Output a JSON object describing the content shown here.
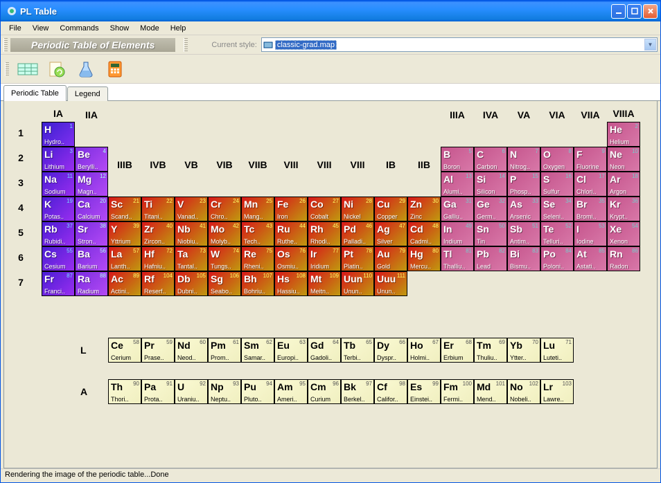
{
  "window": {
    "title": "PL Table"
  },
  "menu": [
    "File",
    "View",
    "Commands",
    "Show",
    "Mode",
    "Help"
  ],
  "banner": "Periodic Table of Elements",
  "styleLabel": "Current style:",
  "styleValue": "classic-grad.map",
  "tabs": [
    {
      "label": "Periodic Table",
      "active": true
    },
    {
      "label": "Legend",
      "active": false
    }
  ],
  "status": "Rendering the image of the periodic table...Done",
  "groupLabels": [
    {
      "t": "IA",
      "col": 0,
      "row": -1
    },
    {
      "t": "IIA",
      "col": 1,
      "row": 0
    },
    {
      "t": "IIIB",
      "col": 2,
      "row": 2
    },
    {
      "t": "IVB",
      "col": 3,
      "row": 2
    },
    {
      "t": "VB",
      "col": 4,
      "row": 2
    },
    {
      "t": "VIB",
      "col": 5,
      "row": 2
    },
    {
      "t": "VIIB",
      "col": 6,
      "row": 2
    },
    {
      "t": "VIII",
      "col": 7,
      "row": 2
    },
    {
      "t": "VIII",
      "col": 8,
      "row": 2
    },
    {
      "t": "VIII",
      "col": 9,
      "row": 2
    },
    {
      "t": "IB",
      "col": 10,
      "row": 2
    },
    {
      "t": "IIB",
      "col": 11,
      "row": 2
    },
    {
      "t": "IIIA",
      "col": 12,
      "row": 0
    },
    {
      "t": "IVA",
      "col": 13,
      "row": 0
    },
    {
      "t": "VA",
      "col": 14,
      "row": 0
    },
    {
      "t": "VIA",
      "col": 15,
      "row": 0
    },
    {
      "t": "VIIA",
      "col": 16,
      "row": 0
    },
    {
      "t": "VIIIA",
      "col": 17,
      "row": -1
    }
  ],
  "periods": [
    "1",
    "2",
    "3",
    "4",
    "5",
    "6",
    "7"
  ],
  "elements": [
    {
      "n": 1,
      "s": "H",
      "nm": "Hydro..",
      "c": "c-h",
      "col": 0,
      "row": 0
    },
    {
      "n": 2,
      "s": "He",
      "nm": "Helium",
      "c": "c-ng",
      "col": 17,
      "row": 0
    },
    {
      "n": 3,
      "s": "Li",
      "nm": "Lithium",
      "c": "c-alk",
      "col": 0,
      "row": 1
    },
    {
      "n": 4,
      "s": "Be",
      "nm": "Berylli..",
      "c": "c-aearth",
      "col": 1,
      "row": 1
    },
    {
      "n": 5,
      "s": "B",
      "nm": "Boron",
      "c": "c-mloid",
      "col": 12,
      "row": 1
    },
    {
      "n": 6,
      "s": "C",
      "nm": "Carbon",
      "c": "c-nm",
      "col": 13,
      "row": 1
    },
    {
      "n": 7,
      "s": "N",
      "nm": "Nitrog..",
      "c": "c-nm",
      "col": 14,
      "row": 1
    },
    {
      "n": 8,
      "s": "O",
      "nm": "Oxygen",
      "c": "c-nm",
      "col": 15,
      "row": 1
    },
    {
      "n": 9,
      "s": "F",
      "nm": "Fluorine",
      "c": "c-hal",
      "col": 16,
      "row": 1
    },
    {
      "n": 10,
      "s": "Ne",
      "nm": "Neon",
      "c": "c-ng",
      "col": 17,
      "row": 1
    },
    {
      "n": 11,
      "s": "Na",
      "nm": "Sodium",
      "c": "c-alk",
      "col": 0,
      "row": 2
    },
    {
      "n": 12,
      "s": "Mg",
      "nm": "Magn..",
      "c": "c-aearth",
      "col": 1,
      "row": 2
    },
    {
      "n": 13,
      "s": "Al",
      "nm": "Alumi..",
      "c": "c-pmet",
      "col": 12,
      "row": 2
    },
    {
      "n": 14,
      "s": "Si",
      "nm": "Silicon",
      "c": "c-mloid",
      "col": 13,
      "row": 2
    },
    {
      "n": 15,
      "s": "P",
      "nm": "Phosp..",
      "c": "c-nm",
      "col": 14,
      "row": 2
    },
    {
      "n": 16,
      "s": "S",
      "nm": "Sulfur",
      "c": "c-nm",
      "col": 15,
      "row": 2
    },
    {
      "n": 17,
      "s": "Cl",
      "nm": "Chlori..",
      "c": "c-hal",
      "col": 16,
      "row": 2
    },
    {
      "n": 18,
      "s": "Ar",
      "nm": "Argon",
      "c": "c-ng",
      "col": 17,
      "row": 2
    },
    {
      "n": 19,
      "s": "K",
      "nm": "Potas..",
      "c": "c-alk",
      "col": 0,
      "row": 3
    },
    {
      "n": 20,
      "s": "Ca",
      "nm": "Calcium",
      "c": "c-aearth",
      "col": 1,
      "row": 3
    },
    {
      "n": 21,
      "s": "Sc",
      "nm": "Scand..",
      "c": "c-tm",
      "col": 2,
      "row": 3
    },
    {
      "n": 22,
      "s": "Ti",
      "nm": "Titani..",
      "c": "c-tm",
      "col": 3,
      "row": 3
    },
    {
      "n": 23,
      "s": "V",
      "nm": "Vanad..",
      "c": "c-tm",
      "col": 4,
      "row": 3
    },
    {
      "n": 24,
      "s": "Cr",
      "nm": "Chro..",
      "c": "c-tm",
      "col": 5,
      "row": 3
    },
    {
      "n": 25,
      "s": "Mn",
      "nm": "Mang..",
      "c": "c-tm",
      "col": 6,
      "row": 3
    },
    {
      "n": 26,
      "s": "Fe",
      "nm": "Iron",
      "c": "c-tm",
      "col": 7,
      "row": 3
    },
    {
      "n": 27,
      "s": "Co",
      "nm": "Cobalt",
      "c": "c-tm",
      "col": 8,
      "row": 3
    },
    {
      "n": 28,
      "s": "Ni",
      "nm": "Nickel",
      "c": "c-tm",
      "col": 9,
      "row": 3
    },
    {
      "n": 29,
      "s": "Cu",
      "nm": "Copper",
      "c": "c-tm",
      "col": 10,
      "row": 3
    },
    {
      "n": 30,
      "s": "Zn",
      "nm": "Zinc",
      "c": "c-tm",
      "col": 11,
      "row": 3
    },
    {
      "n": 31,
      "s": "Ga",
      "nm": "Galliu..",
      "c": "c-pmet",
      "col": 12,
      "row": 3
    },
    {
      "n": 32,
      "s": "Ge",
      "nm": "Germ..",
      "c": "c-mloid",
      "col": 13,
      "row": 3
    },
    {
      "n": 33,
      "s": "As",
      "nm": "Arsenic",
      "c": "c-mloid",
      "col": 14,
      "row": 3
    },
    {
      "n": 34,
      "s": "Se",
      "nm": "Seleni..",
      "c": "c-nm",
      "col": 15,
      "row": 3
    },
    {
      "n": 35,
      "s": "Br",
      "nm": "Bromi..",
      "c": "c-hal",
      "col": 16,
      "row": 3
    },
    {
      "n": 36,
      "s": "Kr",
      "nm": "Krypt..",
      "c": "c-ng",
      "col": 17,
      "row": 3
    },
    {
      "n": 37,
      "s": "Rb",
      "nm": "Rubidi..",
      "c": "c-alk",
      "col": 0,
      "row": 4
    },
    {
      "n": 38,
      "s": "Sr",
      "nm": "Stron..",
      "c": "c-aearth",
      "col": 1,
      "row": 4
    },
    {
      "n": 39,
      "s": "Y",
      "nm": "Yttrium",
      "c": "c-tm",
      "col": 2,
      "row": 4
    },
    {
      "n": 40,
      "s": "Zr",
      "nm": "Zircon..",
      "c": "c-tm",
      "col": 3,
      "row": 4
    },
    {
      "n": 41,
      "s": "Nb",
      "nm": "Niobiu..",
      "c": "c-tm",
      "col": 4,
      "row": 4
    },
    {
      "n": 42,
      "s": "Mo",
      "nm": "Molyb..",
      "c": "c-tm",
      "col": 5,
      "row": 4
    },
    {
      "n": 43,
      "s": "Tc",
      "nm": "Tech..",
      "c": "c-tm",
      "col": 6,
      "row": 4
    },
    {
      "n": 44,
      "s": "Ru",
      "nm": "Ruthe..",
      "c": "c-tm",
      "col": 7,
      "row": 4
    },
    {
      "n": 45,
      "s": "Rh",
      "nm": "Rhodi..",
      "c": "c-tm",
      "col": 8,
      "row": 4
    },
    {
      "n": 46,
      "s": "Pd",
      "nm": "Palladi..",
      "c": "c-tm",
      "col": 9,
      "row": 4
    },
    {
      "n": 47,
      "s": "Ag",
      "nm": "Silver",
      "c": "c-tm",
      "col": 10,
      "row": 4
    },
    {
      "n": 48,
      "s": "Cd",
      "nm": "Cadmi..",
      "c": "c-tm",
      "col": 11,
      "row": 4
    },
    {
      "n": 49,
      "s": "In",
      "nm": "Indium",
      "c": "c-pmet",
      "col": 12,
      "row": 4
    },
    {
      "n": 50,
      "s": "Sn",
      "nm": "Tin",
      "c": "c-pmet",
      "col": 13,
      "row": 4
    },
    {
      "n": 51,
      "s": "Sb",
      "nm": "Antim..",
      "c": "c-mloid",
      "col": 14,
      "row": 4
    },
    {
      "n": 52,
      "s": "Te",
      "nm": "Telluri..",
      "c": "c-mloid",
      "col": 15,
      "row": 4
    },
    {
      "n": 53,
      "s": "I",
      "nm": "Iodine",
      "c": "c-hal",
      "col": 16,
      "row": 4
    },
    {
      "n": 54,
      "s": "Xe",
      "nm": "Xenon",
      "c": "c-ng",
      "col": 17,
      "row": 4
    },
    {
      "n": 55,
      "s": "Cs",
      "nm": "Cesium",
      "c": "c-alk",
      "col": 0,
      "row": 5
    },
    {
      "n": 56,
      "s": "Ba",
      "nm": "Barium",
      "c": "c-aearth",
      "col": 1,
      "row": 5
    },
    {
      "n": 57,
      "s": "La",
      "nm": "Lanth..",
      "c": "c-tm",
      "col": 2,
      "row": 5
    },
    {
      "n": 72,
      "s": "Hf",
      "nm": "Hafniu..",
      "c": "c-tm",
      "col": 3,
      "row": 5
    },
    {
      "n": 73,
      "s": "Ta",
      "nm": "Tantal..",
      "c": "c-tm",
      "col": 4,
      "row": 5
    },
    {
      "n": 74,
      "s": "W",
      "nm": "Tungs..",
      "c": "c-tm",
      "col": 5,
      "row": 5
    },
    {
      "n": 75,
      "s": "Re",
      "nm": "Rheni..",
      "c": "c-tm",
      "col": 6,
      "row": 5
    },
    {
      "n": 76,
      "s": "Os",
      "nm": "Osmiu..",
      "c": "c-tm",
      "col": 7,
      "row": 5
    },
    {
      "n": 77,
      "s": "Ir",
      "nm": "Iridium",
      "c": "c-tm",
      "col": 8,
      "row": 5
    },
    {
      "n": 78,
      "s": "Pt",
      "nm": "Platin..",
      "c": "c-tm",
      "col": 9,
      "row": 5
    },
    {
      "n": 79,
      "s": "Au",
      "nm": "Gold",
      "c": "c-tm",
      "col": 10,
      "row": 5
    },
    {
      "n": 80,
      "s": "Hg",
      "nm": "Mercu..",
      "c": "c-tm",
      "col": 11,
      "row": 5
    },
    {
      "n": 81,
      "s": "Tl",
      "nm": "Thalliu..",
      "c": "c-pmet",
      "col": 12,
      "row": 5
    },
    {
      "n": 82,
      "s": "Pb",
      "nm": "Lead",
      "c": "c-pmet",
      "col": 13,
      "row": 5
    },
    {
      "n": 83,
      "s": "Bi",
      "nm": "Bismu..",
      "c": "c-pmet",
      "col": 14,
      "row": 5
    },
    {
      "n": 84,
      "s": "Po",
      "nm": "Poloni..",
      "c": "c-mloid",
      "col": 15,
      "row": 5
    },
    {
      "n": 85,
      "s": "At",
      "nm": "Astati..",
      "c": "c-hal",
      "col": 16,
      "row": 5
    },
    {
      "n": 86,
      "s": "Rn",
      "nm": "Radon",
      "c": "c-ng",
      "col": 17,
      "row": 5
    },
    {
      "n": 87,
      "s": "Fr",
      "nm": "Franci..",
      "c": "c-alk",
      "col": 0,
      "row": 6
    },
    {
      "n": 88,
      "s": "Ra",
      "nm": "Radium",
      "c": "c-aearth",
      "col": 1,
      "row": 6
    },
    {
      "n": 89,
      "s": "Ac",
      "nm": "Actini..",
      "c": "c-tm",
      "col": 2,
      "row": 6
    },
    {
      "n": 104,
      "s": "Rf",
      "nm": "Reserf..",
      "c": "c-tm",
      "col": 3,
      "row": 6
    },
    {
      "n": 105,
      "s": "Db",
      "nm": "Dubni..",
      "c": "c-tm",
      "col": 4,
      "row": 6
    },
    {
      "n": 106,
      "s": "Sg",
      "nm": "Seabo..",
      "c": "c-tm",
      "col": 5,
      "row": 6
    },
    {
      "n": 107,
      "s": "Bh",
      "nm": "Bohriu..",
      "c": "c-tm",
      "col": 6,
      "row": 6
    },
    {
      "n": 108,
      "s": "Hs",
      "nm": "Hassiu..",
      "c": "c-tm",
      "col": 7,
      "row": 6
    },
    {
      "n": 109,
      "s": "Mt",
      "nm": "Meitn..",
      "c": "c-tm",
      "col": 8,
      "row": 6
    },
    {
      "n": 110,
      "s": "Uun",
      "nm": "Unun..",
      "c": "c-tm",
      "col": 9,
      "row": 6
    },
    {
      "n": 111,
      "s": "Uuu",
      "nm": "Unun..",
      "c": "c-tm",
      "col": 10,
      "row": 6
    }
  ],
  "lanth": [
    {
      "n": 58,
      "s": "Ce",
      "nm": "Cerium"
    },
    {
      "n": 59,
      "s": "Pr",
      "nm": "Prase.."
    },
    {
      "n": 60,
      "s": "Nd",
      "nm": "Neod.."
    },
    {
      "n": 61,
      "s": "Pm",
      "nm": "Prom.."
    },
    {
      "n": 62,
      "s": "Sm",
      "nm": "Samar.."
    },
    {
      "n": 63,
      "s": "Eu",
      "nm": "Europi.."
    },
    {
      "n": 64,
      "s": "Gd",
      "nm": "Gadoli.."
    },
    {
      "n": 65,
      "s": "Tb",
      "nm": "Terbi.."
    },
    {
      "n": 66,
      "s": "Dy",
      "nm": "Dyspr.."
    },
    {
      "n": 67,
      "s": "Ho",
      "nm": "Holmi.."
    },
    {
      "n": 68,
      "s": "Er",
      "nm": "Erbium"
    },
    {
      "n": 69,
      "s": "Tm",
      "nm": "Thuliu.."
    },
    {
      "n": 70,
      "s": "Yb",
      "nm": "Ytter.."
    },
    {
      "n": 71,
      "s": "Lu",
      "nm": "Luteti.."
    }
  ],
  "act": [
    {
      "n": 90,
      "s": "Th",
      "nm": "Thori.."
    },
    {
      "n": 91,
      "s": "Pa",
      "nm": "Prota.."
    },
    {
      "n": 92,
      "s": "U",
      "nm": "Uraniu.."
    },
    {
      "n": 93,
      "s": "Np",
      "nm": "Neptu.."
    },
    {
      "n": 94,
      "s": "Pu",
      "nm": "Pluto.."
    },
    {
      "n": 95,
      "s": "Am",
      "nm": "Ameri.."
    },
    {
      "n": 96,
      "s": "Cm",
      "nm": "Curium"
    },
    {
      "n": 97,
      "s": "Bk",
      "nm": "Berkel.."
    },
    {
      "n": 98,
      "s": "Cf",
      "nm": "Califor.."
    },
    {
      "n": 99,
      "s": "Es",
      "nm": "Einstei.."
    },
    {
      "n": 100,
      "s": "Fm",
      "nm": "Fermi.."
    },
    {
      "n": 101,
      "s": "Md",
      "nm": "Mend.."
    },
    {
      "n": 102,
      "s": "No",
      "nm": "Nobeli.."
    },
    {
      "n": 103,
      "s": "Lr",
      "nm": "Lawre.."
    }
  ],
  "seriesLabels": {
    "l": "L",
    "a": "A"
  }
}
